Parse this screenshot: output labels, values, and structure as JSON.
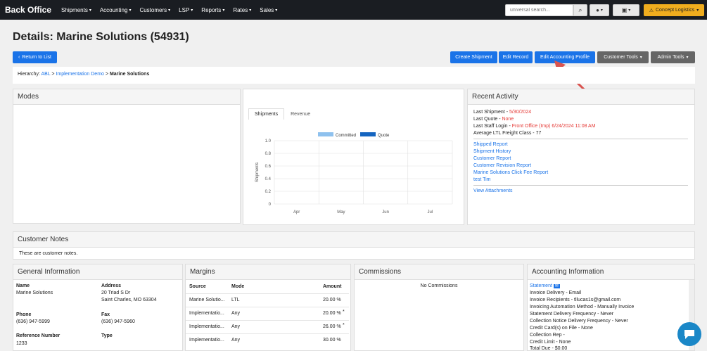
{
  "nav": {
    "brand": "Back Office",
    "items": [
      "Shipments",
      "Accounting",
      "Customers",
      "LSP",
      "Reports",
      "Rates",
      "Sales"
    ],
    "search_placeholder": "universal search...",
    "account": "Concept Logistics"
  },
  "page": {
    "title": "Details: Marine Solutions (54931)"
  },
  "actions": {
    "return": "Return to List",
    "create_shipment": "Create Shipment",
    "edit_record": "Edit Record",
    "edit_accounting": "Edit Accounting Profile",
    "customer_tools": "Customer Tools",
    "admin_tools": "Admin Tools"
  },
  "hierarchy": {
    "label": "Hierarchy:",
    "items": [
      "ABL",
      "Implementation Demo",
      "Marine Solutions"
    ],
    "sep": ">"
  },
  "modes": {
    "title": "Modes"
  },
  "chart_tabs": [
    "Shipments",
    "Revenue"
  ],
  "chart_data": {
    "type": "bar",
    "categories": [
      "Apr",
      "May",
      "Jun",
      "Jul"
    ],
    "series": [
      {
        "name": "Committed",
        "values": [
          0,
          0,
          0,
          0
        ],
        "color": "#8ec1ee"
      },
      {
        "name": "Quote",
        "values": [
          0,
          0,
          0,
          0
        ],
        "color": "#1565c0"
      }
    ],
    "ylabel": "Shipments",
    "ylim": [
      0,
      1.0
    ],
    "yticks": [
      "1.0",
      "0.8",
      "0.6",
      "0.4",
      "0.2",
      "0"
    ]
  },
  "recent": {
    "title": "Recent Activity",
    "last_shipment_label": "Last Shipment - ",
    "last_shipment_value": "5/30/2024",
    "last_quote_label": "Last Quote - ",
    "last_quote_value": "None",
    "last_login_label": "Last Staff Login - ",
    "last_login_value": "Front Office (Imp) 6/24/2024 11:08 AM",
    "avg_class": "Average LTL Freight Class - 77",
    "links": [
      "Shipped Report",
      "Shipment History",
      "Customer Report",
      "Customer Revision Report",
      "Marine Solutions Click Fee Report",
      "test Tim"
    ],
    "attachments": "View Attachments"
  },
  "notes": {
    "title": "Customer Notes",
    "text": "These are customer notes."
  },
  "general": {
    "title": "General Information",
    "name_label": "Name",
    "name": "Marine Solutions",
    "address_label": "Address",
    "address1": "20 Triad S Dr",
    "address2": "Saint Charles, MO 63304",
    "phone_label": "Phone",
    "phone": "(636) 947-5999",
    "fax_label": "Fax",
    "fax": "(636) 947-5960",
    "ref_label": "Reference Number",
    "ref": "1233",
    "type_label": "Type"
  },
  "margins": {
    "title": "Margins",
    "headers": [
      "Source",
      "Mode",
      "Amount"
    ],
    "rows": [
      {
        "source": "Marine Solutio...",
        "mode": "LTL",
        "amount": "20.00 %",
        "star": ""
      },
      {
        "source": "Implementatio...",
        "mode": "Any",
        "amount": "20.00 %",
        "star": "*"
      },
      {
        "source": "Implementatio...",
        "mode": "Any",
        "amount": "26.00 %",
        "star": "*"
      },
      {
        "source": "Implementatio...",
        "mode": "Any",
        "amount": "30.00 %",
        "star": ""
      }
    ]
  },
  "commissions": {
    "title": "Commissions",
    "empty": "No Commissions"
  },
  "accounting": {
    "title": "Accounting Information",
    "statement": "Statement",
    "lines": [
      "Invoice Delivery - Email",
      "Invoice Recipients - tllucas1s@gmail.com",
      "Invoicing Automation Method - Manually Invoice",
      "Statement Delivery Frequency - Never",
      "Collection Notice Delivery Frequency - Never",
      "Credit Card(s) on File - None",
      "Collection Rep -",
      "Credit Limit - None",
      "Total Due - $0.00"
    ]
  }
}
